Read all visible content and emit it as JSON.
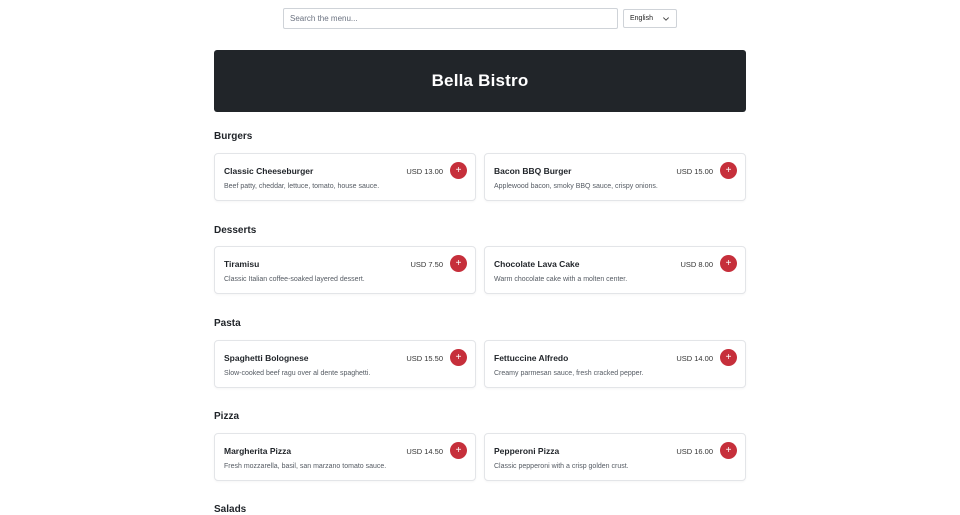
{
  "search": {
    "placeholder": "Search the menu..."
  },
  "language": {
    "selected": "English"
  },
  "hero": {
    "title": "Bella Bistro"
  },
  "currency": "USD",
  "colors": {
    "hero_bg": "#212529",
    "accent": "#c62f3b"
  },
  "sections": [
    {
      "title": "Burgers",
      "items": [
        {
          "name": "Classic Cheeseburger",
          "price": "USD 13.00",
          "description": "Beef patty, cheddar, lettuce, tomato, house sauce.",
          "add_label": "+"
        },
        {
          "name": "Bacon BBQ Burger",
          "price": "USD 15.00",
          "description": "Applewood bacon, smoky BBQ sauce, crispy onions.",
          "add_label": "+"
        }
      ]
    },
    {
      "title": "Desserts",
      "items": [
        {
          "name": "Tiramisu",
          "price": "USD 7.50",
          "description": "Classic Italian coffee-soaked layered dessert.",
          "add_label": "+"
        },
        {
          "name": "Chocolate Lava Cake",
          "price": "USD 8.00",
          "description": "Warm chocolate cake with a molten center.",
          "add_label": "+"
        }
      ]
    },
    {
      "title": "Pasta",
      "items": [
        {
          "name": "Spaghetti Bolognese",
          "price": "USD 15.50",
          "description": "Slow-cooked beef ragu over al dente spaghetti.",
          "add_label": "+"
        },
        {
          "name": "Fettuccine Alfredo",
          "price": "USD 14.00",
          "description": "Creamy parmesan sauce, fresh cracked pepper.",
          "add_label": "+"
        }
      ]
    },
    {
      "title": "Pizza",
      "items": [
        {
          "name": "Margherita Pizza",
          "price": "USD 14.50",
          "description": "Fresh mozzarella, basil, san marzano tomato sauce.",
          "add_label": "+"
        },
        {
          "name": "Pepperoni Pizza",
          "price": "USD 16.00",
          "description": "Classic pepperoni with a crisp golden crust.",
          "add_label": "+"
        }
      ]
    },
    {
      "title": "Salads",
      "items": []
    }
  ]
}
